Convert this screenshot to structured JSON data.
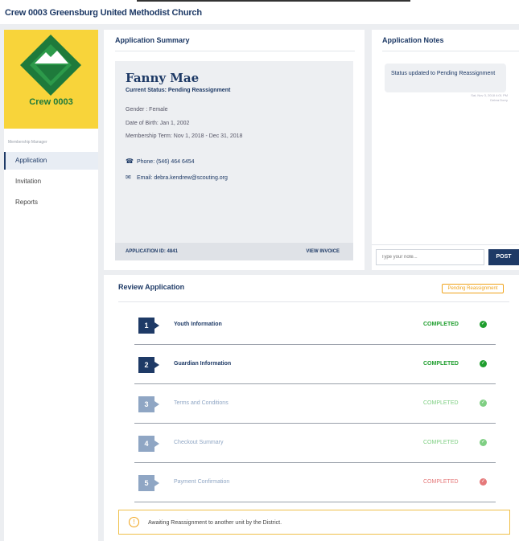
{
  "header": {
    "title": "Crew 0003 Greensburg United Methodist Church"
  },
  "sidebar": {
    "logo_label": "Crew 0003",
    "section_label": "Membership Manager",
    "items": [
      {
        "label": "Application",
        "active": true
      },
      {
        "label": "Invitation",
        "active": false
      },
      {
        "label": "Reports",
        "active": false
      }
    ]
  },
  "summary": {
    "title": "Application Summary",
    "name": "Fanny Mae",
    "status": "Current Status:  Pending Reassignment",
    "gender": "Gender : Female",
    "dob": "Date of Birth: Jan 1, 2002",
    "term": "Membership Term: Nov 1, 2018 - Dec 31, 2018",
    "phone": "Phone:  (546) 464 6454",
    "email": "Email:  debra.kendrew@scouting.org",
    "application_id": "APPLICATION ID: 4841",
    "view_invoice": "VIEW INVOICE"
  },
  "notes": {
    "title": "Application Notes",
    "note_text": "Status updated to Pending Reassignment",
    "note_meta_1": "Sat, Nov 3, 2018 4:01 PM",
    "note_meta_2": "Debra Dorry",
    "input_placeholder": "Type your note...",
    "post_label": "POST"
  },
  "review": {
    "title": "Review Application",
    "badge": "Pending Reassignment",
    "steps": [
      {
        "num": "1",
        "label": "Youth Information",
        "state": "COMPLETED"
      },
      {
        "num": "2",
        "label": "Guardian Information",
        "state": "COMPLETED"
      },
      {
        "num": "3",
        "label": "Terms and Conditions",
        "state": "COMPLETED"
      },
      {
        "num": "4",
        "label": "Checkout Summary",
        "state": "COMPLETED"
      },
      {
        "num": "5",
        "label": "Payment Confirmation",
        "state": "COMPLETED"
      }
    ],
    "alert": "Awaiting Reassignment to another unit by the District."
  },
  "colors": {
    "navy": "#1e3a66",
    "green": "#1f9e2e",
    "light_green": "#7fcf83",
    "red": "#e5797a",
    "amber": "#f0a31a",
    "logo_yellow": "#f8d43a"
  }
}
